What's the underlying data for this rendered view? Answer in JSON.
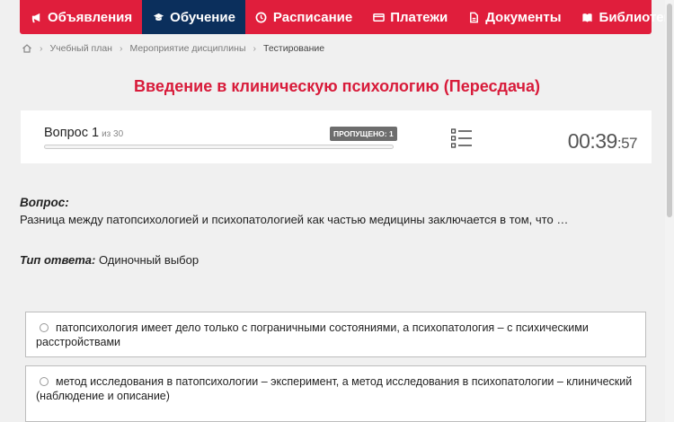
{
  "nav": {
    "items": [
      {
        "label": "Объявления",
        "icon": "megaphone-icon"
      },
      {
        "label": "Обучение",
        "icon": "graduation-cap-icon"
      },
      {
        "label": "Расписание",
        "icon": "clock-icon"
      },
      {
        "label": "Платежи",
        "icon": "card-icon"
      },
      {
        "label": "Документы",
        "icon": "document-icon"
      },
      {
        "label": "Библиотека",
        "icon": "book-icon"
      }
    ],
    "active_index": 1,
    "colors": {
      "bar": "#e01e3c",
      "active": "#0b2f5c"
    }
  },
  "breadcrumb": [
    "Учебный план",
    "Мероприятие дисциплины",
    "Тестирование"
  ],
  "page_title": "Введение в клиническую психологию (Пересдача)",
  "question_bar": {
    "label": "Вопрос 1",
    "of": "из 30",
    "progress": 0.0,
    "skipped_badge": "ПРОПУЩЕНО: 1",
    "timer_main": "00:39",
    "timer_sec": ":57"
  },
  "question": {
    "label": "Вопрос:",
    "text": "Разница между патопсихологией и психопатологией как частью медицины заключается в том, что …"
  },
  "answer_type": {
    "label": "Тип ответа:",
    "value": "Одиночный выбор"
  },
  "options": [
    {
      "text": "патопсихология имеет дело только с пограничными состояниями, а психопатология – с психическими расстройствами"
    },
    {
      "text": "метод исследования в патопсихологии – эксперимент, а метод исследования в психопатологии – клинический (наблюдение и описание)"
    }
  ]
}
